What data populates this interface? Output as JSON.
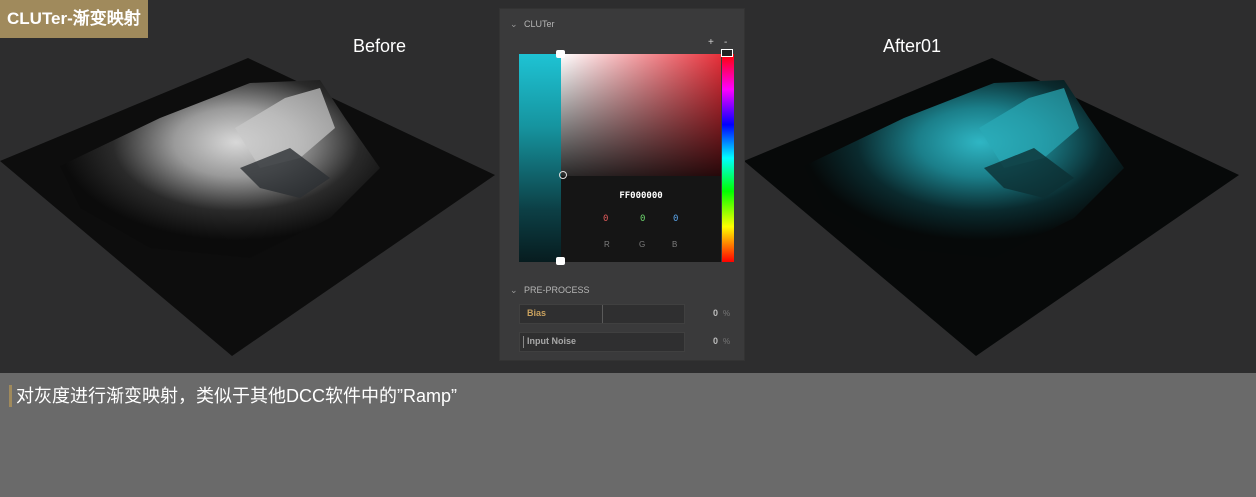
{
  "header": {
    "title": "CLUTer-渐变映射"
  },
  "images": {
    "before_label": "Before",
    "after_label": "After01"
  },
  "panel": {
    "section_title": "CLUTer",
    "plus": "+",
    "minus": "-",
    "hex": "FF000000",
    "rgb": {
      "r": "0",
      "g": "0",
      "b": "0"
    },
    "rgb_labels": {
      "r": "R",
      "g": "G",
      "b": "B"
    },
    "preprocess_title": "PRE-PROCESS",
    "bias": {
      "label": "Bias",
      "value": "0",
      "unit": "%"
    },
    "noise": {
      "label": "Input Noise",
      "value": "0",
      "unit": "%"
    }
  },
  "caption": "对灰度进行渐变映射，类似于其他DCC软件中的”Ramp”",
  "colors": {
    "accent": "#a08a5c",
    "teal": "#1ec3d4",
    "red": "#e8303a"
  }
}
